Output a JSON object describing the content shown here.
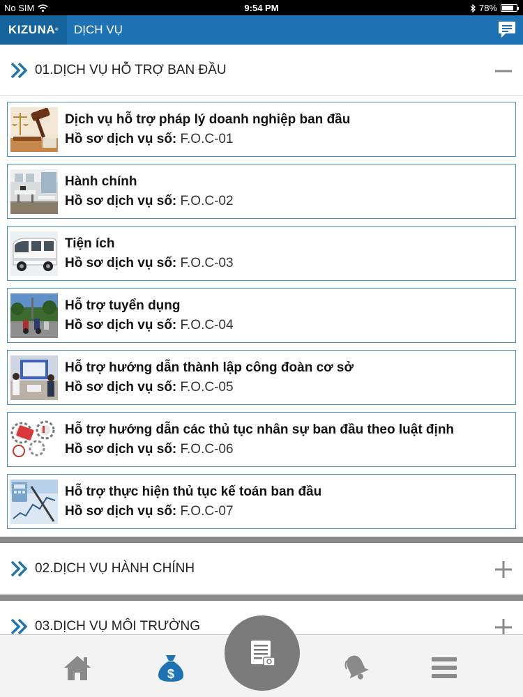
{
  "status_bar": {
    "carrier": "No SIM",
    "time": "9:54 PM",
    "battery": "78%",
    "battery_level": 0.78
  },
  "header": {
    "logo": "KIZUNA",
    "title": "DỊCH VỤ"
  },
  "sections": [
    {
      "title": "01.DỊCH VỤ HỖ TRỢ BAN ĐẦU",
      "expanded": true,
      "items": [
        {
          "name": "Dịch vụ hỗ trợ pháp lý doanh nghiệp ban đầu",
          "code_label": "Hồ sơ dịch vụ số:",
          "code": " F.O.C-01"
        },
        {
          "name": "Hành chính",
          "code_label": "Hồ sơ dịch vụ số:",
          "code": " F.O.C-02"
        },
        {
          "name": "Tiện ích",
          "code_label": "Hồ sơ dịch vụ số:",
          "code": " F.O.C-03"
        },
        {
          "name": "Hỗ trợ tuyển dụng",
          "code_label": "Hồ sơ dịch vụ số:",
          "code": " F.O.C-04"
        },
        {
          "name": "Hỗ trợ hướng dẫn thành lập công đoàn cơ sở",
          "code_label": "Hồ sơ dịch vụ số:",
          "code": " F.O.C-05"
        },
        {
          "name": "Hỗ trợ hướng dẫn các thủ tục nhân sự ban đầu theo luật định",
          "code_label": "Hồ sơ dịch vụ số:",
          "code": " F.O.C-06"
        },
        {
          "name": "Hỗ trợ thực hiện thủ tục kế toán ban đầu",
          "code_label": "Hồ sơ dịch vụ số:",
          "code": " F.O.C-07"
        }
      ]
    },
    {
      "title": "02.DỊCH VỤ HÀNH CHÍNH",
      "expanded": false
    },
    {
      "title": "03.DỊCH VỤ MÔI TRƯỜNG",
      "expanded": false
    }
  ],
  "tab_bar": {
    "tabs": [
      "home-icon",
      "money-bag-icon",
      "service-document-icon",
      "bell-icon",
      "menu-icon"
    ],
    "active_tab": "money-bag-icon"
  },
  "colors": {
    "header_bg": "#1d73b4",
    "logo_bg": "#16649e",
    "accent": "#1d73b4",
    "item_border": "#4a8ec7",
    "section_separator": "#8a8a8a"
  }
}
